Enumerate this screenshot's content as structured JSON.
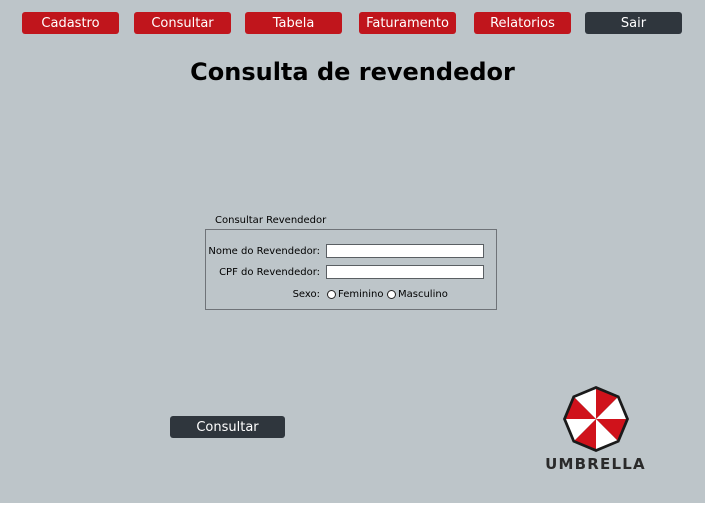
{
  "nav": {
    "items": [
      {
        "label": "Cadastro"
      },
      {
        "label": "Consultar"
      },
      {
        "label": "Tabela"
      },
      {
        "label": "Faturamento"
      },
      {
        "label": "Relatorios"
      },
      {
        "label": "Sair"
      }
    ]
  },
  "page": {
    "title": "Consulta de revendedor"
  },
  "form": {
    "legend": "Consultar Revendedor",
    "name_label": "Nome do Revendedor:",
    "name_value": "",
    "cpf_label": "CPF do Revendedor:",
    "cpf_value": "",
    "sex_label": "Sexo:",
    "sex_options": [
      "Feminino",
      "Masculino"
    ],
    "submit_label": "Consultar"
  },
  "brand": {
    "name": "UMBRELLA"
  },
  "colors": {
    "accent": "#c0151c",
    "dark": "#2f363d",
    "background": "#bdc5c9"
  }
}
